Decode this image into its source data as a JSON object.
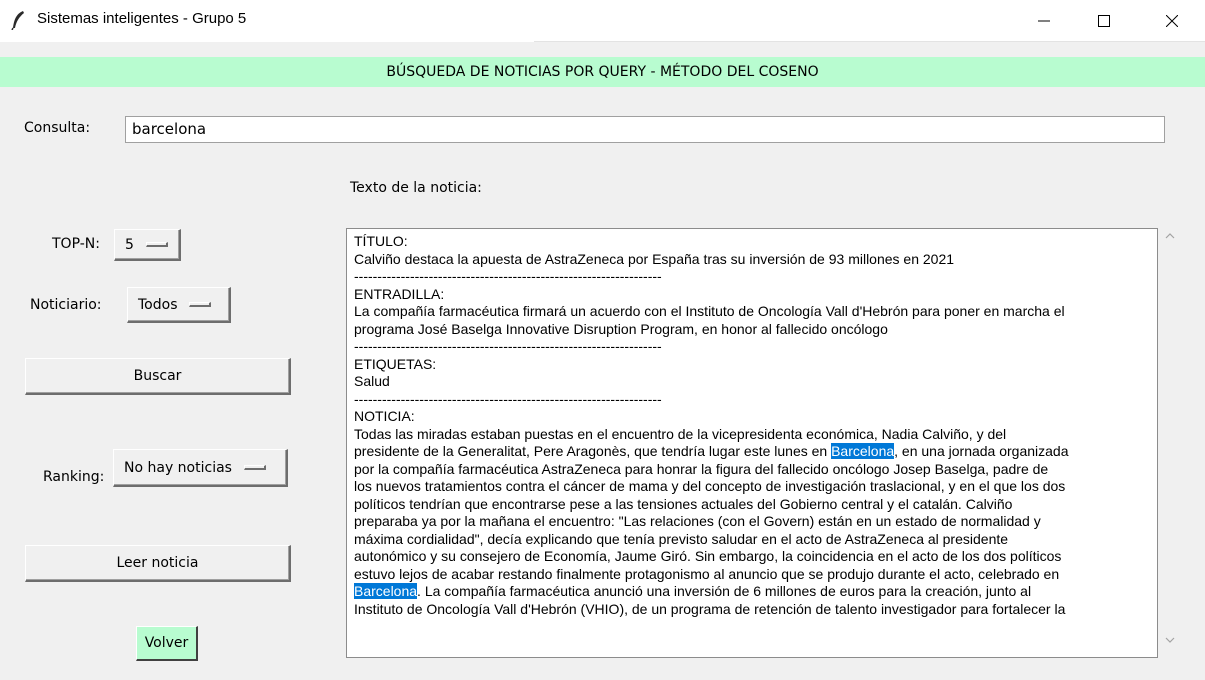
{
  "window": {
    "title": "Sistemas inteligentes - Grupo 5",
    "icon": "feather-icon",
    "controls": [
      "minimize-icon",
      "maximize-icon",
      "close-icon"
    ]
  },
  "banner": {
    "text": "BÚSQUEDA DE NOTICIAS POR QUERY - MÉTODO DEL COSENO",
    "color": "#b8fcd0"
  },
  "query": {
    "label": "Consulta:",
    "value": "barcelona"
  },
  "article_label": "Texto de la noticia:",
  "topn": {
    "label": "TOP-N:",
    "value": "5"
  },
  "source": {
    "label": "Noticiario:",
    "value": "Todos"
  },
  "search_button": "Buscar",
  "ranking": {
    "label": "Ranking:",
    "value": "No hay noticias"
  },
  "read_button": "Leer noticia",
  "back_button": "Volver",
  "highlight_term": "Barcelona",
  "highlight_color": "#0078d7",
  "article": {
    "title_header": "TÍTULO:",
    "title": "Calviño destaca la apuesta de AstraZeneca por España tras su inversión de 93 millones en 2021",
    "separator": "------------------------------------------------------------------",
    "lead_header": "ENTRADILLA:",
    "lead_lines": [
      "La compañía farmacéutica firmará un acuerdo con el Instituto de Oncología Vall d'Hebrón para poner en marcha el",
      "programa José Baselga Innovative Disruption Program, en honor al fallecido oncólogo"
    ],
    "tags_header": "ETIQUETAS:",
    "tags": "Salud",
    "news_header": "NOTICIA:",
    "news_lines": [
      "Todas las miradas estaban puestas en el encuentro de la vicepresidenta económica, Nadia Calviño, y del",
      "presidente de la Generalitat, Pere Aragonès, que tendría lugar este lunes en ",
      ", en una jornada organizada",
      "por la compañía farmacéutica AstraZeneca para honrar la figura del fallecido oncólogo Josep Baselga, padre de",
      "los nuevos tratamientos contra el cáncer de mama y del concepto de investigación traslacional, y en el que los dos",
      "políticos tendrían que encontrarse pese a las tensiones actuales del Gobierno central y el catalán. Calviño",
      "preparaba ya por la mañana el encuentro: \"Las relaciones (con el Govern) están en un estado de normalidad y",
      "máxima cordialidad\", decía explicando que tenía previsto saludar en el acto de AstraZeneca al presidente",
      "autonómico y su consejero de Economía, Jaume Giró. Sin embargo, la coincidencia en el acto de los dos políticos",
      "estuvo lejos de acabar restando finalmente protagonismo al anuncio que se produjo durante el acto, celebrado en",
      ". La compañía farmacéutica anunció una inversión de 6 millones de euros para la creación, junto al",
      "Instituto de Oncología Vall d'Hebrón (VHIO), de un programa de retención de talento investigador para fortalecer la"
    ]
  }
}
